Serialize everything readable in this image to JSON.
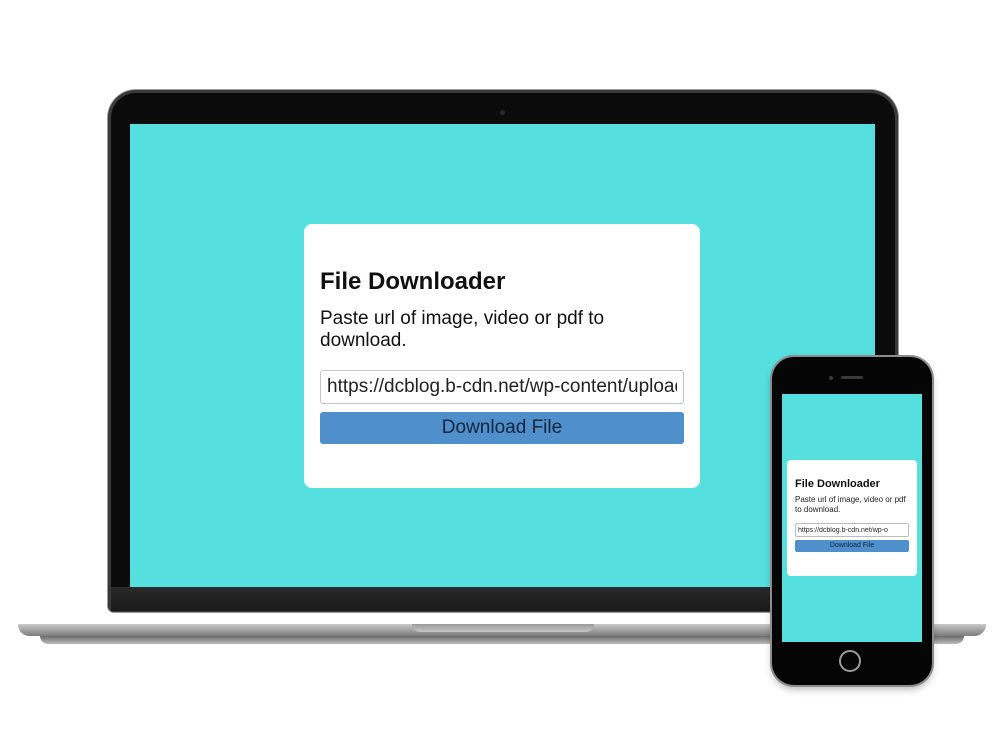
{
  "laptop": {
    "app": {
      "title": "File Downloader",
      "subtitle": "Paste url of image, video or pdf to download.",
      "url_value": "https://dcblog.b-cdn.net/wp-content/uploads",
      "download_label": "Download File"
    }
  },
  "phone": {
    "app": {
      "title": "File Downloader",
      "subtitle": "Paste url of image, video or pdf to download.",
      "url_value": "https://dcblog.b-cdn.net/wp-o",
      "download_label": "Download File"
    }
  },
  "colors": {
    "background": "#55dfdf",
    "card": "#ffffff",
    "button": "#4e8fcc",
    "device_frame": "#0b0b0b"
  }
}
